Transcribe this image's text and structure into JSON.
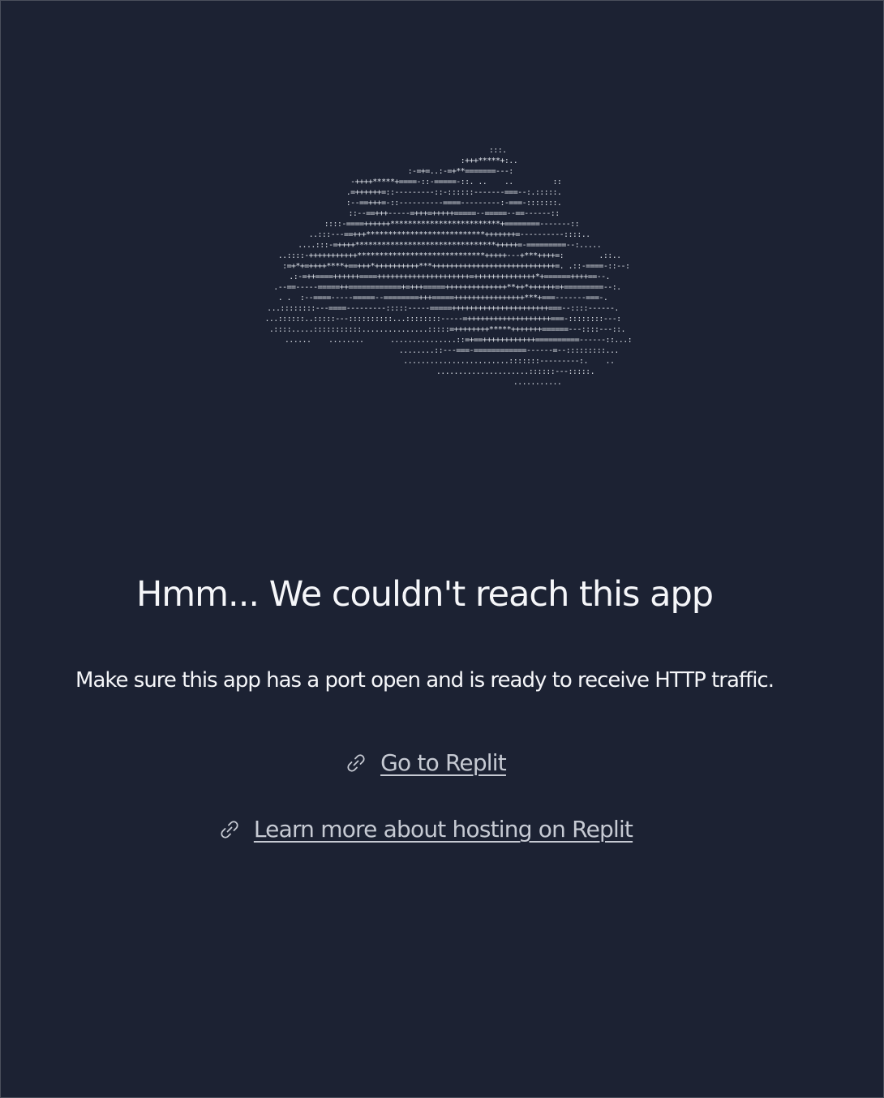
{
  "ascii_art": "                         :::.\n                     :+++*****+:..\n        :-=+=..:-=+**=======---:\n      -++++*****+====-::-=====-::. ..    ..         ::\n     .=++++++=::---------::-::::::-------===--:.:::::.\n     :--==+++=-::----------====---------:-===-:::::::.\n     ::--==+++-----=+++=+++++=====--=====--==------::\n    ::::-====++++++*************************+========-------::\n   ..:::---==+++***************************+++++++=----------::::..\n   ....:::-=++++********************************+++++=-=========--:.....\n   ..::::-+++++++++++*****************************+++++---+***++++=:        .::..\n      :=+*+=++++****+==+++*++++++++++***++++++++++++++++++++++++++++=. .::-====-::--:\n   .:-=++====++++++====+++++++++++++++++++++=++++++++++++++*+======++++==--.\n  .--==-----=====++============+=+++=====++++++++++++++**++*++++++=+=========--:.\n. .  :--====-----=====--========+++=====++++++++++++++++***+===-------===-.\n...::::::::---====---------:::::-----=====++++++++++++++++++++++===--::::------.\n...::::::..:::::---::::::::::...::::::::-----=+++++++++++++++++++===-::::::::---:\n  .::::.....:::::::::::...............:::::=++++++++*****+++++++======---::::---::.\n       ......    ........      ...............::=+==++++++++++++==========------::...:\n                              ........::---===-============------=--:::::::::...\n                              ........................:::::::---------:.    ..\n                                 .....................::::::---:::::.\n                                           ...........",
  "error_title": "Hmm... We couldn't reach this app",
  "error_message": "Make sure this app has a port open and is ready to receive HTTP traffic.",
  "links": [
    {
      "label": "Go to Replit",
      "icon": "link-icon"
    },
    {
      "label": "Learn more about hosting on Replit",
      "icon": "link-icon"
    }
  ],
  "colors": {
    "background": "#1c2233",
    "text": "#f5f6f9",
    "link": "#c6cad3"
  }
}
